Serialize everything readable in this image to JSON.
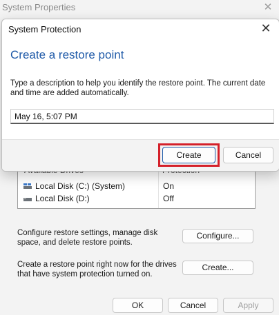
{
  "background_window": {
    "title": "System Properties",
    "close_glyph": "✕",
    "drives_table": {
      "columns": [
        "Available Drives",
        "Protection"
      ],
      "rows": [
        {
          "name": "Local Disk (C:) (System)",
          "protection": "On",
          "icon": "system-drive-icon"
        },
        {
          "name": "Local Disk (D:)",
          "protection": "Off",
          "icon": "drive-icon"
        }
      ]
    },
    "configure_text": "Configure restore settings, manage disk space, and delete restore points.",
    "configure_button": "Configure...",
    "create_text": "Create a restore point right now for the drives that have system protection turned on.",
    "create_button": "Create...",
    "ok_button": "OK",
    "cancel_button": "Cancel",
    "apply_button": "Apply"
  },
  "dialog": {
    "title": "System Protection",
    "close_glyph": "✕",
    "heading": "Create a restore point",
    "description": "Type a description to help you identify the restore point. The current date and time are added automatically.",
    "input_value": "May 16, 5:07 PM",
    "create_button": "Create",
    "cancel_button": "Cancel",
    "accent_color": "#1f5aa8",
    "highlight_color": "#d4202a"
  }
}
